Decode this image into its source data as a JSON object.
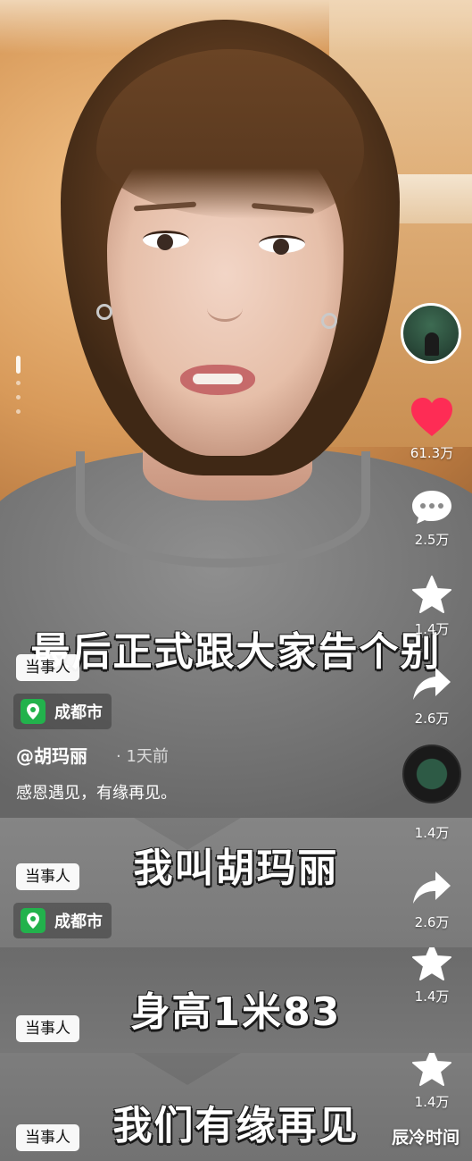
{
  "side_actions": {
    "likes": "61.3万",
    "comments": "2.5万",
    "favorites": "1.4万",
    "shares": "2.6万"
  },
  "frames": [
    {
      "subtitle": "最后正式跟大家告个别",
      "tag": "当事人",
      "location": "成都市",
      "author": "@胡玛丽",
      "time": "· 1天前",
      "caption": "感恩遇见，有缘再见。"
    },
    {
      "subtitle": "我叫胡玛丽",
      "tag": "当事人",
      "location": "成都市",
      "favorites": "1.4万",
      "shares": "2.6万"
    },
    {
      "subtitle": "身高1米83",
      "tag": "当事人",
      "favorites": "1.4万"
    },
    {
      "subtitle": "我们有缘再见",
      "tag": "当事人",
      "favorites": "1.4万"
    }
  ],
  "watermark": "辰冷时间",
  "icons": {
    "like": "heart-icon",
    "comment": "comment-bubble-icon",
    "favorite": "star-icon",
    "share": "share-arrow-icon",
    "location": "location-pin-icon"
  },
  "colors": {
    "like": "#fe2c55",
    "location_pin": "#22b24c"
  }
}
